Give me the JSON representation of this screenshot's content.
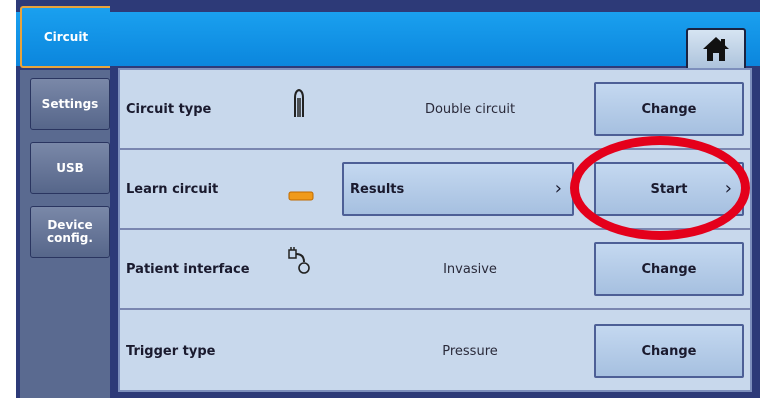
{
  "colors": {
    "header": "#0b86dd",
    "panel": "#c8d8ec",
    "button": "#a6c0e0",
    "active_tab_border": "#e8a33c",
    "highlight": "#e4001b",
    "learn_indicator": "#f09a1a"
  },
  "header": {
    "active_tab": "Circuit",
    "home_icon": "home-icon"
  },
  "sidebar": {
    "tabs": [
      {
        "label": "Settings"
      },
      {
        "label": "USB"
      },
      {
        "label": "Device config."
      }
    ]
  },
  "rows": [
    {
      "label": "Circuit type",
      "icon": "double-circuit-icon",
      "value": "Double circuit",
      "button": "Change"
    },
    {
      "label": "Learn circuit",
      "icon": "learn-status-indicator-icon",
      "results_button": "Results",
      "button": "Start"
    },
    {
      "label": "Patient interface",
      "icon": "invasive-interface-icon",
      "value": "Invasive",
      "button": "Change"
    },
    {
      "label": "Trigger type",
      "value": "Pressure",
      "button": "Change"
    }
  ]
}
